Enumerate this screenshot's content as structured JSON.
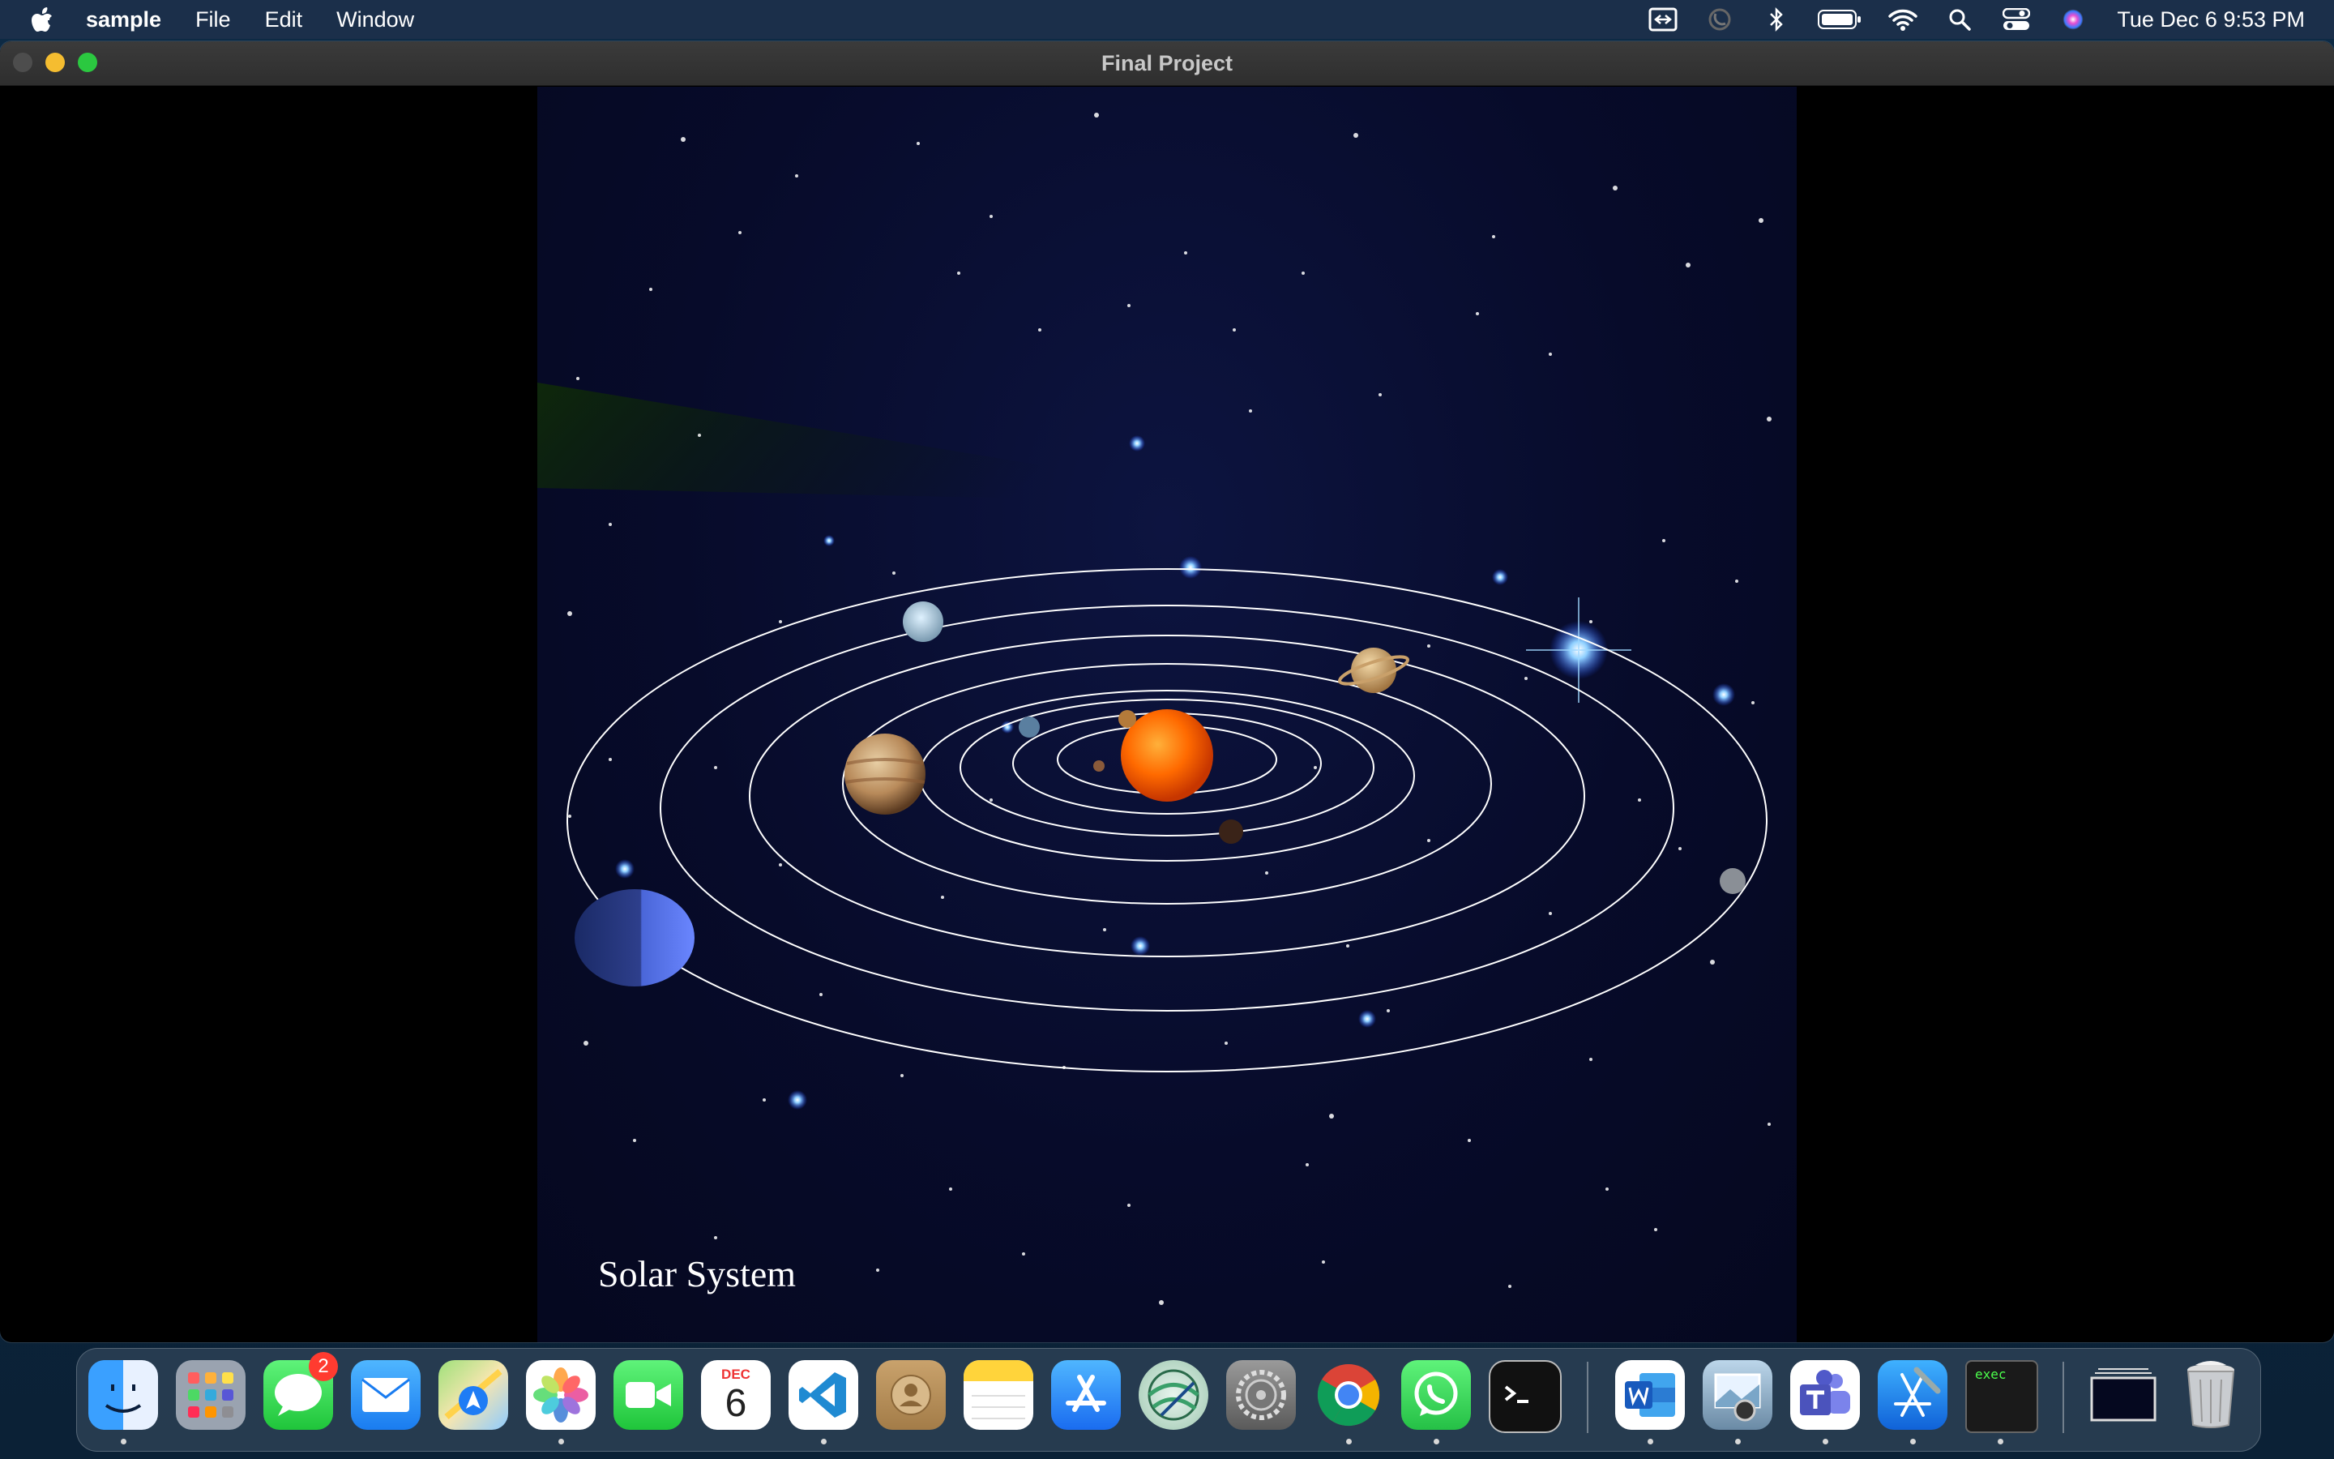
{
  "menubar": {
    "app_name": "sample",
    "menus": [
      "File",
      "Edit",
      "Window"
    ],
    "clock": "Tue Dec 6  9:53 PM",
    "status_icons": [
      "display-mirroring-icon",
      "focus-moon-icon",
      "bluetooth-icon",
      "battery-icon",
      "wifi-icon",
      "spotlight-search-icon",
      "control-center-icon",
      "siri-icon"
    ]
  },
  "window": {
    "title": "Final Project",
    "scene_label": "Solar System"
  },
  "dock": {
    "apps": [
      {
        "name": "Finder",
        "icon": "finder-icon",
        "running": true
      },
      {
        "name": "Launchpad",
        "icon": "launchpad-icon",
        "running": false
      },
      {
        "name": "Messages",
        "icon": "messages-icon",
        "running": false,
        "badge": "2"
      },
      {
        "name": "Mail",
        "icon": "mail-icon",
        "running": false
      },
      {
        "name": "Maps",
        "icon": "maps-icon",
        "running": false
      },
      {
        "name": "Photos",
        "icon": "photos-icon",
        "running": true
      },
      {
        "name": "FaceTime",
        "icon": "facetime-icon",
        "running": false
      },
      {
        "name": "Calendar",
        "icon": "calendar-icon",
        "running": false,
        "month": "DEC",
        "day": "6"
      },
      {
        "name": "Visual Studio Code",
        "icon": "vscode-icon",
        "running": true
      },
      {
        "name": "Contacts",
        "icon": "contacts-icon",
        "running": false
      },
      {
        "name": "Notes",
        "icon": "notes-icon",
        "running": false
      },
      {
        "name": "App Store",
        "icon": "app-store-icon",
        "running": false
      },
      {
        "name": "Network Radar",
        "icon": "network-globe-icon",
        "running": false
      },
      {
        "name": "System Preferences",
        "icon": "system-preferences-icon",
        "running": false
      },
      {
        "name": "Google Chrome",
        "icon": "chrome-icon",
        "running": true
      },
      {
        "name": "WhatsApp",
        "icon": "whatsapp-icon",
        "running": true
      },
      {
        "name": "Terminal",
        "icon": "terminal-icon",
        "running": false
      },
      {
        "name": "Microsoft Word",
        "icon": "word-icon",
        "running": true
      },
      {
        "name": "Preview",
        "icon": "preview-icon",
        "running": true
      },
      {
        "name": "Microsoft Teams",
        "icon": "teams-icon",
        "running": true
      },
      {
        "name": "Xcode",
        "icon": "xcode-icon",
        "running": true
      },
      {
        "name": "exec",
        "icon": "exec-terminal-icon",
        "running": true,
        "label": "exec"
      },
      {
        "name": "Downloads Stack",
        "icon": "window-stack-icon",
        "running": false
      },
      {
        "name": "Trash",
        "icon": "trash-icon",
        "running": false
      }
    ]
  },
  "colors": {
    "sun": "#ff6a00",
    "orbit": "#ffffff",
    "space": "#070b2a"
  }
}
